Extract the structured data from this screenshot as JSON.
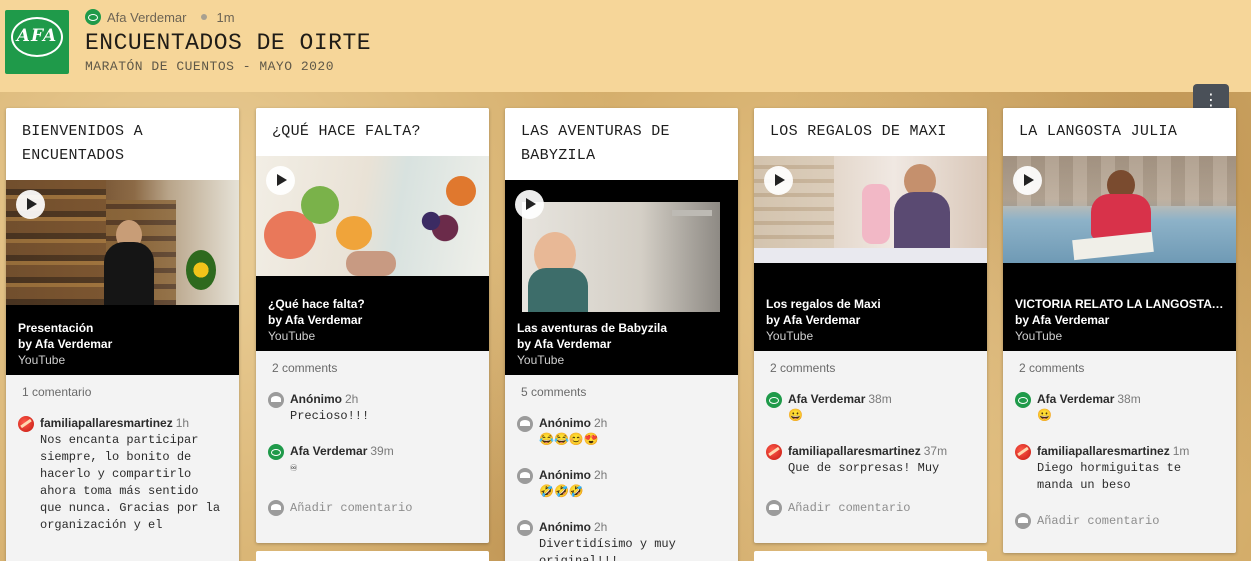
{
  "header": {
    "logo_text": "AFA",
    "author": "Afa Verdemar",
    "time": "1m",
    "title": "ENCUENTADOS DE OIRTE",
    "subtitle": "MARATÓN DE CUENTOS - MAYO 2020"
  },
  "menu_label": "⋮",
  "add_comment_placeholder": "Añadir comentario",
  "columns": [
    {
      "title": "BIENVENIDOS A ENCUENTADOS",
      "video": {
        "title": "Presentación",
        "by": "by Afa Verdemar",
        "source": "YouTube"
      },
      "count": "1 comentario",
      "comments": [
        {
          "author": "familiapallaresmartinez",
          "time": "1h",
          "text": "Nos encanta participar siempre, lo bonito de hacerlo y compartirlo ahora toma más sentido que nunca. Gracias por la organización y el"
        }
      ]
    },
    {
      "title": "¿QUÉ HACE FALTA?",
      "video": {
        "title": "¿Qué hace falta?",
        "by": "by Afa Verdemar",
        "source": "YouTube"
      },
      "count": "2 comments",
      "comments": [
        {
          "author": "Anónimo",
          "time": "2h",
          "text": "Precioso!!!"
        },
        {
          "author": "Afa Verdemar",
          "time": "39m",
          "text": "♾"
        }
      ]
    },
    {
      "title": "LAS AVENTURAS DE BABYZILA",
      "video": {
        "title": "Las aventuras de Babyzila",
        "by": "by Afa Verdemar",
        "source": "YouTube"
      },
      "count": "5 comments",
      "comments": [
        {
          "author": "Anónimo",
          "time": "2h",
          "text": "😂😂😊😍"
        },
        {
          "author": "Anónimo",
          "time": "2h",
          "text": "🤣🤣🤣"
        },
        {
          "author": "Anónimo",
          "time": "2h",
          "text": "Divertidísimo y muy original!!!"
        }
      ]
    },
    {
      "title": "LOS REGALOS DE MAXI",
      "video": {
        "title": "Los regalos de Maxi",
        "by": "by Afa Verdemar",
        "source": "YouTube"
      },
      "count": "2 comments",
      "comments": [
        {
          "author": "Afa Verdemar",
          "time": "38m",
          "text": "😀"
        },
        {
          "author": "familiapallaresmartinez",
          "time": "37m",
          "text": "Que de sorpresas! Muy"
        }
      ]
    },
    {
      "title": "LA LANGOSTA JULIA",
      "video": {
        "title": "VICTORIA RELATO LA LANGOSTA JULIA",
        "by": "by Afa Verdemar",
        "source": "YouTube"
      },
      "count": "2 comments",
      "comments": [
        {
          "author": "Afa Verdemar",
          "time": "38m",
          "text": "😀"
        },
        {
          "author": "familiapallaresmartinez",
          "time": "1m",
          "text": "Diego hormiguitas te manda un beso"
        }
      ]
    }
  ]
}
